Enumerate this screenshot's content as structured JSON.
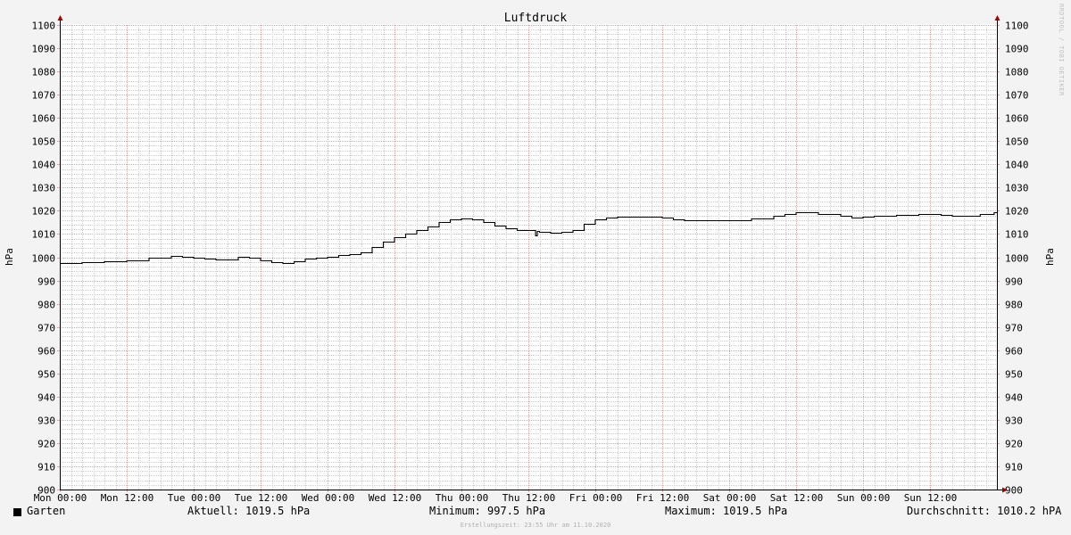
{
  "chart_data": {
    "type": "line",
    "title": "Luftdruck",
    "ylabel": "hPa",
    "ylim": [
      900,
      1100
    ],
    "yticks": [
      900,
      910,
      920,
      930,
      940,
      950,
      960,
      970,
      980,
      990,
      1000,
      1010,
      1020,
      1030,
      1040,
      1050,
      1060,
      1070,
      1080,
      1090,
      1100
    ],
    "xlim": [
      0,
      168
    ],
    "xticks": [
      {
        "h": 0,
        "label": "Mon 00:00"
      },
      {
        "h": 12,
        "label": "Mon 12:00"
      },
      {
        "h": 24,
        "label": "Tue 00:00"
      },
      {
        "h": 36,
        "label": "Tue 12:00"
      },
      {
        "h": 48,
        "label": "Wed 00:00"
      },
      {
        "h": 60,
        "label": "Wed 12:00"
      },
      {
        "h": 72,
        "label": "Thu 00:00"
      },
      {
        "h": 84,
        "label": "Thu 12:00"
      },
      {
        "h": 96,
        "label": "Fri 00:00"
      },
      {
        "h": 108,
        "label": "Fri 12:00"
      },
      {
        "h": 120,
        "label": "Sat 00:00"
      },
      {
        "h": 132,
        "label": "Sat 12:00"
      },
      {
        "h": 144,
        "label": "Sun 00:00"
      },
      {
        "h": 156,
        "label": "Sun 12:00"
      }
    ],
    "grid": true,
    "series": [
      {
        "name": "Garten",
        "color": "#000000",
        "x": [
          0,
          4,
          8,
          12,
          16,
          20,
          22,
          24,
          26,
          28,
          30,
          32,
          34,
          36,
          38,
          40,
          42,
          44,
          46,
          48,
          50,
          52,
          54,
          56,
          58,
          60,
          62,
          64,
          66,
          68,
          70,
          72,
          74,
          76,
          78,
          80,
          82,
          84,
          85.3,
          85.6,
          86,
          88,
          90,
          92,
          94,
          96,
          98,
          100,
          104,
          108,
          110,
          112,
          116,
          120,
          124,
          128,
          130,
          132,
          134,
          136,
          140,
          142,
          144,
          146,
          150,
          154,
          156,
          158,
          160,
          162,
          165,
          167.5
        ],
        "values": [
          997.5,
          997.8,
          998.2,
          998.8,
          999.8,
          1000.6,
          1000.3,
          999.7,
          999.3,
          999.0,
          999.2,
          1000.3,
          999.8,
          998.8,
          998.0,
          997.5,
          998.1,
          999.3,
          999.9,
          1000.3,
          1000.9,
          1001.3,
          1002.2,
          1004.3,
          1006.9,
          1008.8,
          1010.2,
          1011.7,
          1013.3,
          1015.3,
          1016.5,
          1016.7,
          1016.4,
          1015.3,
          1013.5,
          1012.3,
          1011.8,
          1011.6,
          1009.5,
          1011.5,
          1011.0,
          1010.6,
          1011.0,
          1011.8,
          1014.3,
          1016.5,
          1017.1,
          1017.3,
          1017.6,
          1017.0,
          1016.2,
          1015.9,
          1015.9,
          1015.9,
          1016.8,
          1017.8,
          1018.8,
          1019.5,
          1019.4,
          1018.8,
          1017.9,
          1017.2,
          1017.5,
          1018.0,
          1018.3,
          1018.6,
          1018.8,
          1018.4,
          1017.7,
          1017.8,
          1018.6,
          1019.3
        ]
      }
    ]
  },
  "legend": {
    "series_name": "Garten",
    "aktuell": "Aktuell: 1019.5 hPa",
    "minimum": "Minimum: 997.5 hPa",
    "maximum": "Maximum: 1019.5 hPa",
    "durchschnitt": "Durchschnitt: 1010.2 hPA"
  },
  "footer": "Erstellungszeit: 23:55 Uhr am 11.10.2020",
  "watermark": "RRDTOOL / TOBI OETIKER",
  "colors": {
    "background": "#f3f3f3",
    "plot": "#ffffff",
    "major_grid": "#e8a0a0",
    "minor_grid": "#cccccc",
    "axis_arrow": "#a00000",
    "line": "#000000"
  }
}
